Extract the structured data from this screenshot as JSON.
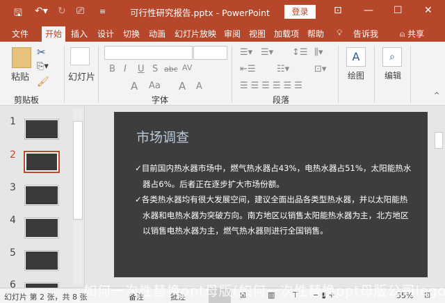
{
  "titlebar": {
    "doc_title": "可行性研究报告.pptx  -  PowerPoint",
    "login_label": "登录"
  },
  "tabs": [
    "文件",
    "开始",
    "插入",
    "设计",
    "切换",
    "动画",
    "幻灯片放映",
    "审阅",
    "视图",
    "加载项",
    "帮助",
    "告诉我",
    "共享"
  ],
  "active_tab": "开始",
  "ribbon": {
    "paste_label": "粘贴",
    "clipboard_label": "剪贴板",
    "slides_label": "幻灯片",
    "font_label": "字体",
    "paragraph_label": "段落",
    "drawing_label": "绘图",
    "editing_label": "编辑",
    "font_buttons": [
      "B",
      "I",
      "U",
      "S",
      "abc",
      "AV",
      "A",
      "Aa",
      "A",
      "A"
    ]
  },
  "thumbnails": {
    "numbers": [
      "1",
      "2",
      "3",
      "4",
      "5",
      "6"
    ],
    "selected": 2
  },
  "slide": {
    "title": "市场调查",
    "bullets": [
      "✓目前国内热水器市场中，燃气热水器占43%，电热水器占51%，太阳能热水器占6%。后者正在逐步扩大市场份额。",
      "✓各类热水器均有很大发展空间，建议全面出品各类型热水器，并以太阳能热水器和电热水器为突破方向。南方地区以销售太阳能热水器为主，北方地区以销售电热水器为主，燃气热水器则进行全国销售。"
    ]
  },
  "status": {
    "slide_info": "幻灯片 第 2 张，共 8 张",
    "notes": "备注",
    "comments": "批注",
    "zoom": "55%"
  },
  "watermark": "如何一次性替换ppt母版(如何一次性替换ppt母版公司logo)",
  "colors": {
    "accent": "#b7472a",
    "slide_bg": "#3d3d3d",
    "slide_title": "#b9c9dc"
  }
}
